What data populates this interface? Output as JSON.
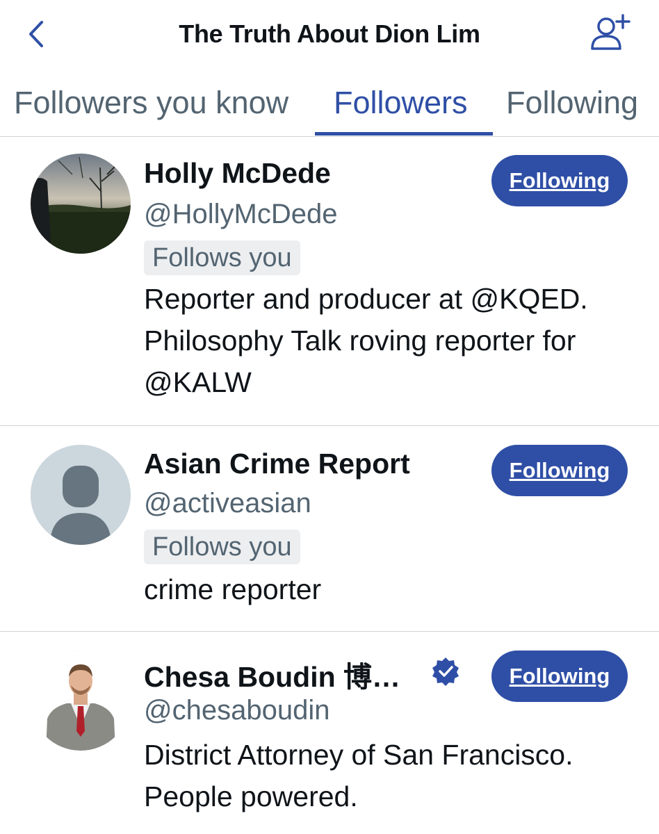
{
  "header": {
    "title": "The Truth About Dion Lim",
    "back_icon": "chevron-left-icon",
    "add_user_icon": "add-user-icon",
    "accent_color": "#2f4fa6"
  },
  "tabs": [
    {
      "label": "Followers you know",
      "active": false
    },
    {
      "label": "Followers",
      "active": true
    },
    {
      "label": "Following",
      "active": false
    }
  ],
  "users": [
    {
      "name": "Holly McDede",
      "handle": "@HollyMcDede",
      "follows_you": "Follows you",
      "bio_lines": [
        "Reporter and producer at @KQED.",
        "Philosophy Talk roving reporter for",
        "@KALW"
      ],
      "button_label": "Following",
      "verified": false,
      "avatar": "landscape-photo"
    },
    {
      "name": "Asian Crime Report",
      "handle": "@activeasian",
      "follows_you": "Follows you",
      "bio_lines": [
        "crime reporter"
      ],
      "button_label": "Following",
      "verified": false,
      "avatar": "default-avatar"
    },
    {
      "name": "Chesa Boudin 博…",
      "handle": "@chesaboudin",
      "bio_lines": [
        "District Attorney of San Francisco.",
        "People powered."
      ],
      "button_label": "Following",
      "verified": true,
      "avatar": "portrait-photo"
    }
  ]
}
